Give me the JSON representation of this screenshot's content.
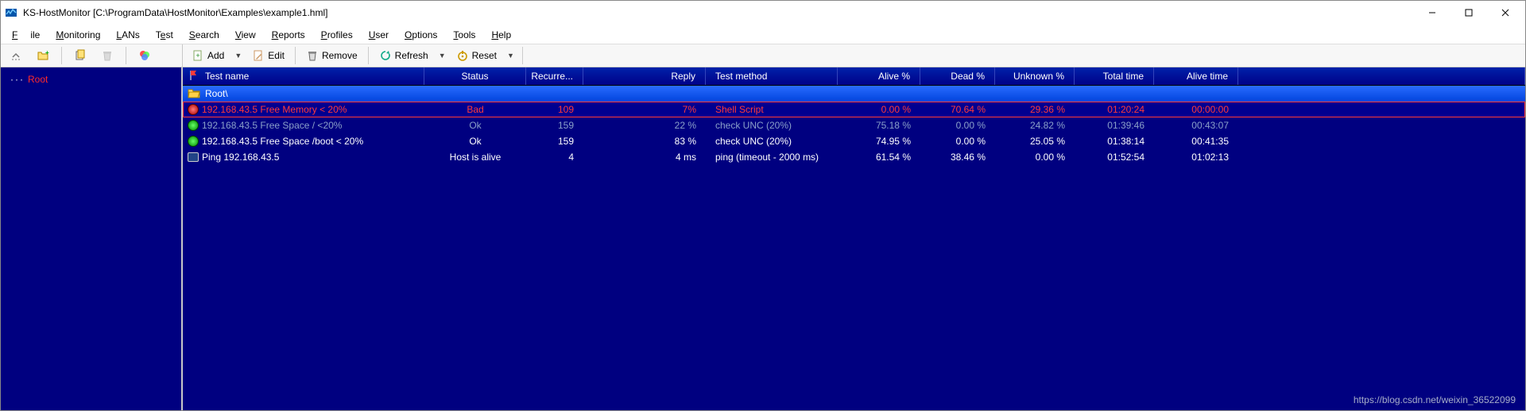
{
  "title": "KS-HostMonitor  [C:\\ProgramData\\HostMonitor\\Examples\\example1.hml]",
  "menu": {
    "file": "File",
    "monitoring": "Monitoring",
    "lans": "LANs",
    "test": "Test",
    "search": "Search",
    "view": "View",
    "reports": "Reports",
    "profiles": "Profiles",
    "user": "User",
    "options": "Options",
    "tools": "Tools",
    "help": "Help"
  },
  "toolbar": {
    "add": "Add",
    "edit": "Edit",
    "remove": "Remove",
    "refresh": "Refresh",
    "reset": "Reset"
  },
  "tree": {
    "root": "Root"
  },
  "columns": {
    "name": "Test name",
    "status": "Status",
    "recur": "Recurre...",
    "reply": "Reply",
    "method": "Test method",
    "alive": "Alive %",
    "dead": "Dead %",
    "unknown": "Unknown %",
    "total": "Total time",
    "alivet": "Alive time"
  },
  "group": {
    "label": "Root\\"
  },
  "rows": [
    {
      "style": "bad",
      "icon": "red",
      "name": "192.168.43.5 Free Memory < 20%",
      "status": "Bad",
      "recur": "109",
      "reply": "7%",
      "method": "Shell Script",
      "alive": "0.00 %",
      "dead": "70.64 %",
      "unknown": "29.36 %",
      "total": "01:20:24",
      "alivet": "00:00:00"
    },
    {
      "style": "dim",
      "icon": "green",
      "name": "192.168.43.5 Free Space / <20%",
      "status": "Ok",
      "recur": "159",
      "reply": "22 %",
      "method": "check UNC (20%)",
      "alive": "75.18 %",
      "dead": "0.00 %",
      "unknown": "24.82 %",
      "total": "01:39:46",
      "alivet": "00:43:07"
    },
    {
      "style": "ok",
      "icon": "green",
      "name": "192.168.43.5 Free Space /boot < 20%",
      "status": "Ok",
      "recur": "159",
      "reply": "83 %",
      "method": "check UNC (20%)",
      "alive": "74.95 %",
      "dead": "0.00 %",
      "unknown": "25.05 %",
      "total": "01:38:14",
      "alivet": "00:41:35"
    },
    {
      "style": "ok",
      "icon": "mon",
      "name": "Ping 192.168.43.5",
      "status": "Host is alive",
      "recur": "4",
      "reply": "4 ms",
      "method": "ping (timeout - 2000 ms)",
      "alive": "61.54 %",
      "dead": "38.46 %",
      "unknown": "0.00 %",
      "total": "01:52:54",
      "alivet": "01:02:13"
    }
  ],
  "watermark": "https://blog.csdn.net/weixin_36522099"
}
